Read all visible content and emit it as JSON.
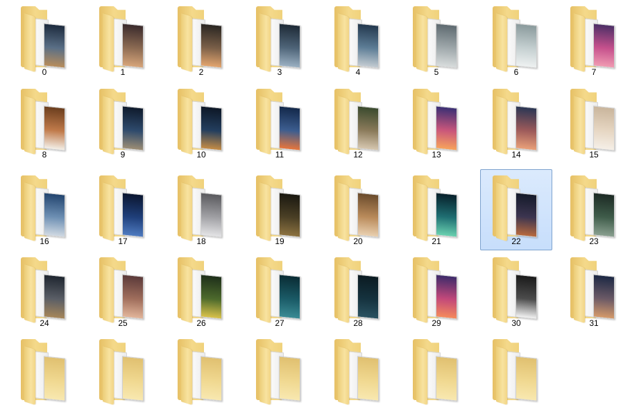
{
  "folders": [
    {
      "label": "0",
      "photo": [
        "#1d2b3e",
        "#5a6f86",
        "#b88d5c"
      ]
    },
    {
      "label": "1",
      "photo": [
        "#3a2a2c",
        "#8b6a52",
        "#d7a57a"
      ]
    },
    {
      "label": "2",
      "photo": [
        "#2a2622",
        "#7a5f48",
        "#e3a56e"
      ]
    },
    {
      "label": "3",
      "photo": [
        "#1e2a36",
        "#4e6478",
        "#9bb0c2"
      ]
    },
    {
      "label": "4",
      "photo": [
        "#23384e",
        "#5d7d96",
        "#c3cbd1"
      ]
    },
    {
      "label": "5",
      "photo": [
        "#5e6a70",
        "#9fa8ab",
        "#d8dcdc"
      ]
    },
    {
      "label": "6",
      "photo": [
        "#8a9a9c",
        "#c4cfd0",
        "#eef1f1"
      ]
    },
    {
      "label": "7",
      "photo": [
        "#4c2f66",
        "#c5508c",
        "#f09bb2"
      ]
    },
    {
      "label": "8",
      "photo": [
        "#6b3e1e",
        "#c07a4a",
        "#f3efe8"
      ]
    },
    {
      "label": "9",
      "photo": [
        "#0f1a2c",
        "#2e4a6c",
        "#9c8d74"
      ]
    },
    {
      "label": "10",
      "photo": [
        "#0d1726",
        "#233e5e",
        "#c58c45"
      ]
    },
    {
      "label": "11",
      "photo": [
        "#13284a",
        "#3c5d8f",
        "#e7753b"
      ]
    },
    {
      "label": "12",
      "photo": [
        "#3a4a2e",
        "#8a7a5a",
        "#d6c7b0"
      ]
    },
    {
      "label": "13",
      "photo": [
        "#3a2f74",
        "#c9567b",
        "#f7a35c"
      ]
    },
    {
      "label": "14",
      "photo": [
        "#2a3654",
        "#9c5a5a",
        "#e9a079"
      ]
    },
    {
      "label": "15",
      "photo": [
        "#c9b59c",
        "#e6d6c2",
        "#f5efe7"
      ]
    },
    {
      "label": "16",
      "photo": [
        "#23456f",
        "#6d8fb3",
        "#d0d9e2"
      ]
    },
    {
      "label": "17",
      "photo": [
        "#0b1630",
        "#1f3f7a",
        "#4f7bc0"
      ]
    },
    {
      "label": "18",
      "photo": [
        "#5a5a5e",
        "#a0a0a4",
        "#e3e3e5"
      ]
    },
    {
      "label": "19",
      "photo": [
        "#1a1810",
        "#4a3f25",
        "#8c7240"
      ]
    },
    {
      "label": "20",
      "photo": [
        "#6a4b2c",
        "#b98a5a",
        "#e9d0b0"
      ]
    },
    {
      "label": "21",
      "photo": [
        "#07202a",
        "#1f6e72",
        "#6ad1b0"
      ]
    },
    {
      "label": "22",
      "photo": [
        "#141a2a",
        "#3c3550",
        "#b86a3e"
      ]
    },
    {
      "label": "23",
      "photo": [
        "#1c2a24",
        "#3f5c4a",
        "#8aa090"
      ]
    },
    {
      "label": "24",
      "photo": [
        "#1f2630",
        "#5a5e66",
        "#a6865a"
      ]
    },
    {
      "label": "25",
      "photo": [
        "#5b3a3a",
        "#a06e5c",
        "#e2b59a"
      ]
    },
    {
      "label": "26",
      "photo": [
        "#1e2f1a",
        "#4d6a2c",
        "#d9c24a"
      ]
    },
    {
      "label": "27",
      "photo": [
        "#0a2c34",
        "#1a5a66",
        "#3b8b94"
      ]
    },
    {
      "label": "28",
      "photo": [
        "#0b1b22",
        "#15323e",
        "#2a5261"
      ]
    },
    {
      "label": "29",
      "photo": [
        "#3d2b6a",
        "#c2487a",
        "#f58a5c"
      ]
    },
    {
      "label": "30",
      "photo": [
        "#1a1a1a",
        "#4c4c4c",
        "#f2f2f2"
      ]
    },
    {
      "label": "31",
      "photo": [
        "#1c2844",
        "#6c5a66",
        "#d59a6a"
      ]
    },
    {
      "label": "",
      "photo": [
        "#e0c070",
        "#f0d890",
        "#f8e8b0"
      ]
    },
    {
      "label": "",
      "photo": [
        "#e0c070",
        "#f0d890",
        "#f8e8b0"
      ]
    },
    {
      "label": "",
      "photo": [
        "#e0c070",
        "#f0d890",
        "#f8e8b0"
      ]
    },
    {
      "label": "",
      "photo": [
        "#e0c070",
        "#f0d890",
        "#f8e8b0"
      ]
    },
    {
      "label": "",
      "photo": [
        "#e0c070",
        "#f0d890",
        "#f8e8b0"
      ]
    },
    {
      "label": "",
      "photo": [
        "#e0c070",
        "#f0d890",
        "#f8e8b0"
      ]
    },
    {
      "label": "",
      "photo": [
        "#e0c070",
        "#f0d890",
        "#f8e8b0"
      ]
    }
  ],
  "selected_label": "22"
}
